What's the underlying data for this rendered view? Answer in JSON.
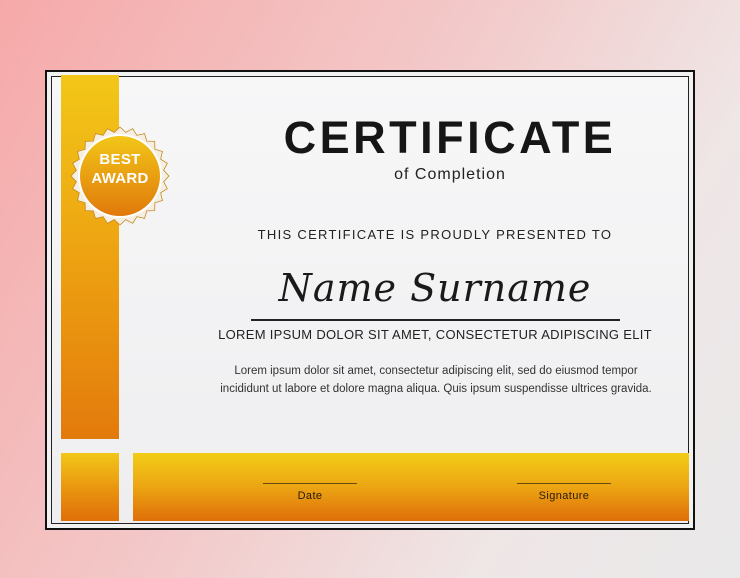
{
  "certificate": {
    "title": "CERTIFICATE",
    "subtitle": "of Completion",
    "presented_to": "THIS CERTIFICATE IS PROUDLY PRESENTED TO",
    "recipient_name": "Name Surname",
    "tagline": "LOREM IPSUM DOLOR SIT AMET, CONSECTETUR ADIPISCING ELIT",
    "body": "Lorem ipsum dolor sit amet, consectetur adipiscing elit, sed do eiusmod tempor incididunt ut labore et dolore magna aliqua. Quis ipsum suspendisse ultrices gravida.",
    "date_label": "Date",
    "signature_label": "Signature"
  },
  "badge": {
    "line1": "BEST",
    "line2": "AWARD"
  },
  "colors": {
    "gold_light": "#f2c718",
    "gold_mid": "#eea612",
    "orange_dark": "#de6e09",
    "text_dark": "#161616"
  }
}
